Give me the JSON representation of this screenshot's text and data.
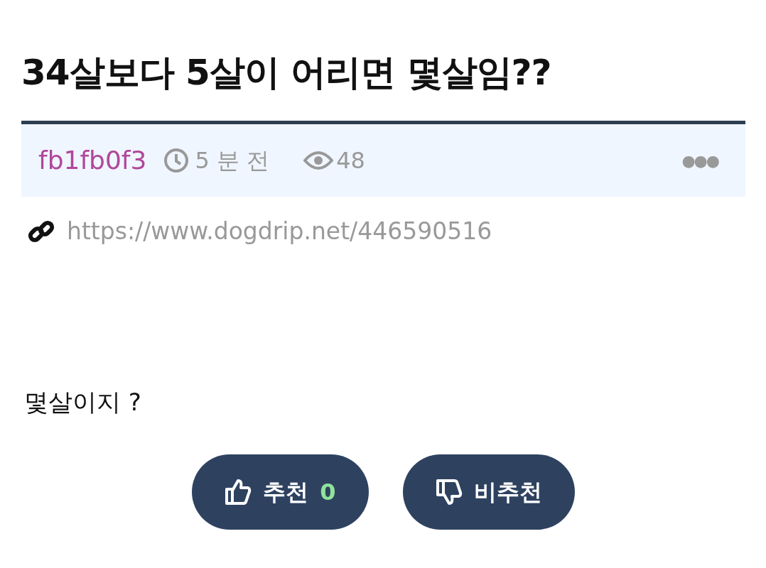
{
  "post": {
    "title": "34살보다 5살이 어리면 몇살임??",
    "meta": {
      "author": "fb1fb0f3",
      "time": "5 분 전",
      "views": "48",
      "more": "●●●"
    },
    "link": "https://www.dogdrip.net/446590516",
    "body": "몇살이지 ?",
    "votes": [
      {
        "kind": "up",
        "label": "추천",
        "count": "0"
      },
      {
        "kind": "down",
        "label": "비추천"
      }
    ]
  }
}
